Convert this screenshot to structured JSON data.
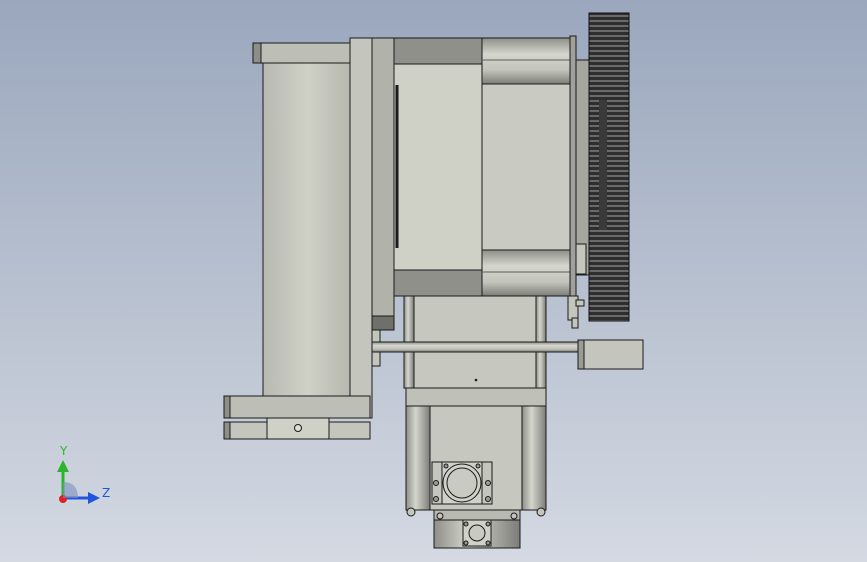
{
  "viewport": {
    "colors": {
      "background_top": "#9aa7bd",
      "background_bottom": "#d4d9e2",
      "body_fill": "#c8c9bf",
      "body_dark": "#8c8d86",
      "gear_dark": "#2c2c2c",
      "outline": "#1a1a1a"
    }
  },
  "triad": {
    "y_label": "Y",
    "z_label": "Z",
    "y_color": "#2bb52b",
    "z_color": "#2255dd",
    "x_color": "#dd2222"
  }
}
